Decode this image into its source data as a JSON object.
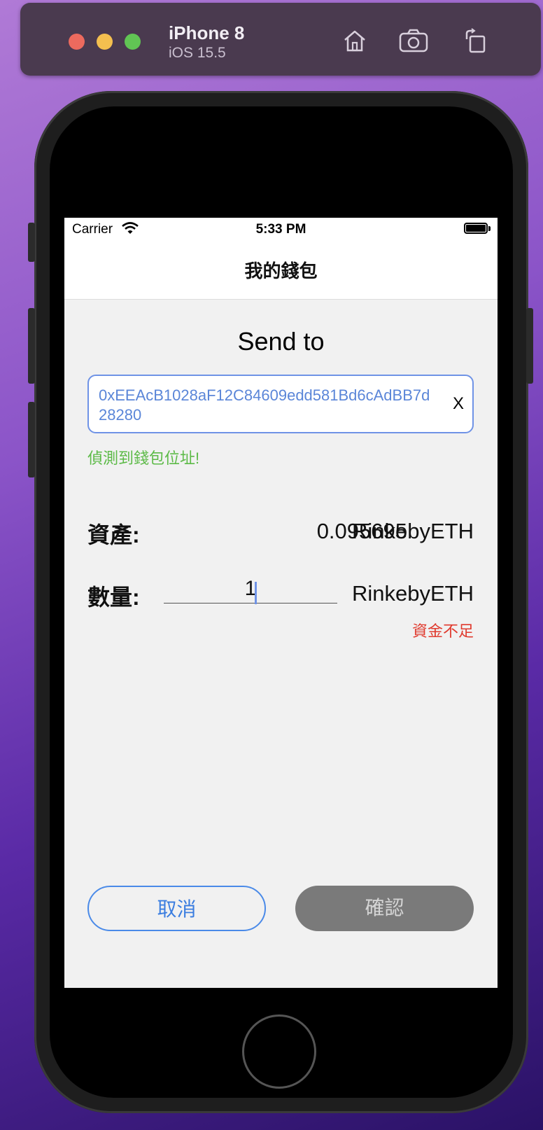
{
  "simulator": {
    "device_name": "iPhone 8",
    "os_version": "iOS 15.5",
    "toolbar_icons": [
      "home-icon",
      "screenshot-icon",
      "rotate-icon"
    ]
  },
  "status_bar": {
    "carrier": "Carrier",
    "time": "5:33 PM"
  },
  "nav": {
    "title": "我的錢包"
  },
  "form": {
    "heading": "Send to",
    "address": "0xEEAcB1028aF12C84609edd581Bd6cAdBB7d28280",
    "clear_label": "X",
    "address_detected_msg": "偵測到錢包位址!",
    "asset_label": "資產:",
    "asset_value": "0.095695",
    "asset_unit": "RinkebyETH",
    "quantity_label": "數量:",
    "quantity_value": "1",
    "quantity_unit": "RinkebyETH",
    "error_msg": "資金不足"
  },
  "buttons": {
    "cancel": "取消",
    "confirm": "確認"
  },
  "colors": {
    "accent": "#4a8ae8",
    "success": "#5cba47",
    "error": "#e03a2e",
    "disabled": "#7a7a7a"
  }
}
